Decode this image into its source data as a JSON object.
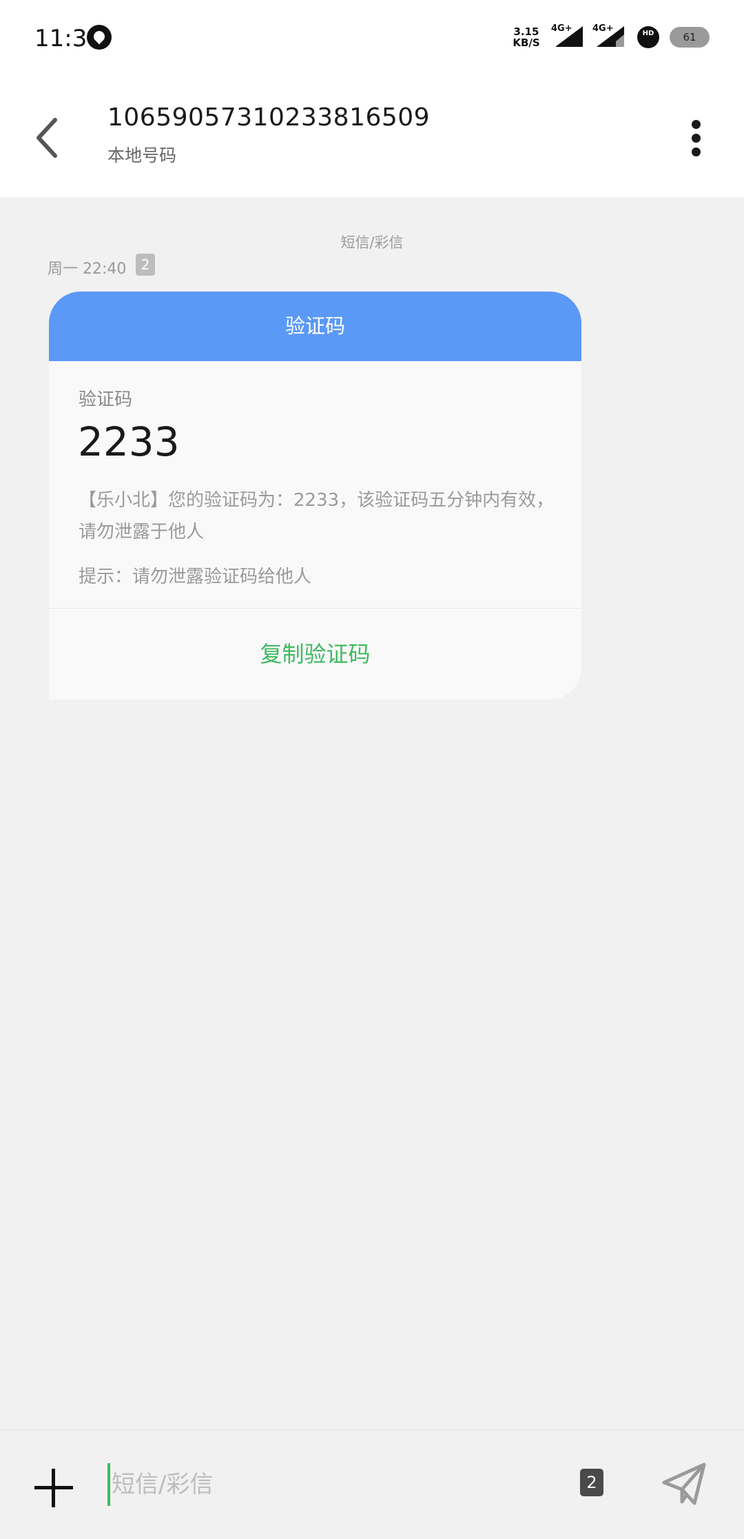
{
  "status_bar": {
    "time": "11:31",
    "speed_value": "3.15",
    "speed_unit": "KB/S",
    "network_1": "4G+",
    "network_2": "4G+",
    "hd_label": "HD",
    "battery": "61",
    "icons": [
      "app-notification-icon",
      "signal-icon",
      "signal-icon",
      "hd-voice-icon",
      "battery-icon"
    ]
  },
  "header": {
    "number": "1065905731023381650​9",
    "subtitle": "本地号码",
    "icons": [
      "back-arrow-icon",
      "more-vertical-icon"
    ]
  },
  "thread": {
    "channel_label": "短信/彩信",
    "time": "周一 22:40",
    "sim": "2"
  },
  "otp_card": {
    "header": "验证码",
    "label": "验证码",
    "code": "2233",
    "body": "【乐小北】您的验证码为：2233，该验证码五分钟内有效，请勿泄露于他人",
    "hint": "提示：请勿泄露验证码给他人",
    "copy_label": "复制验证码"
  },
  "input_bar": {
    "placeholder": "短信/彩信",
    "sim": "2",
    "icons": [
      "add-icon",
      "send-icon"
    ]
  },
  "colors": {
    "card_header": "#5b99f7",
    "accent_green": "#3fb960",
    "background": "#f1f1f1"
  }
}
